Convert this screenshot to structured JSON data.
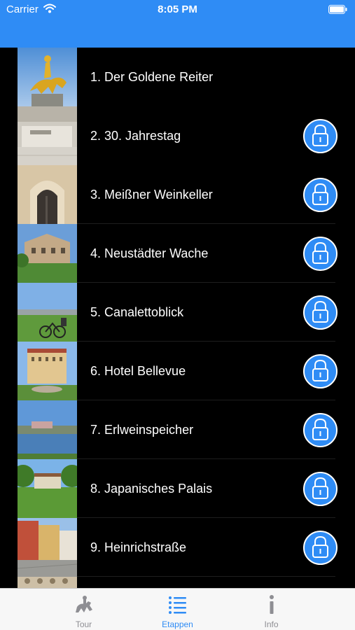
{
  "status_bar": {
    "carrier": "Carrier",
    "time": "8:05 PM"
  },
  "colors": {
    "accent": "#2f8cf5",
    "background": "#000000",
    "tab_inactive": "#8e8e93"
  },
  "stages": [
    {
      "label": "1. Der Goldene Reiter",
      "locked": false
    },
    {
      "label": "2. 30. Jahrestag",
      "locked": true
    },
    {
      "label": "3. Meißner Weinkeller",
      "locked": true
    },
    {
      "label": "4. Neustädter Wache",
      "locked": true
    },
    {
      "label": "5. Canalettoblick",
      "locked": true
    },
    {
      "label": "6. Hotel Bellevue",
      "locked": true
    },
    {
      "label": "7. Erlweinspeicher",
      "locked": true
    },
    {
      "label": "8. Japanisches Palais",
      "locked": true
    },
    {
      "label": "9. Heinrichstraße",
      "locked": true
    }
  ],
  "tabbar": {
    "tabs": [
      {
        "label": "Tour",
        "icon": "equestrian-statue-icon",
        "active": false
      },
      {
        "label": "Etappen",
        "icon": "list-icon",
        "active": true
      },
      {
        "label": "Info",
        "icon": "info-icon",
        "active": false
      }
    ]
  }
}
